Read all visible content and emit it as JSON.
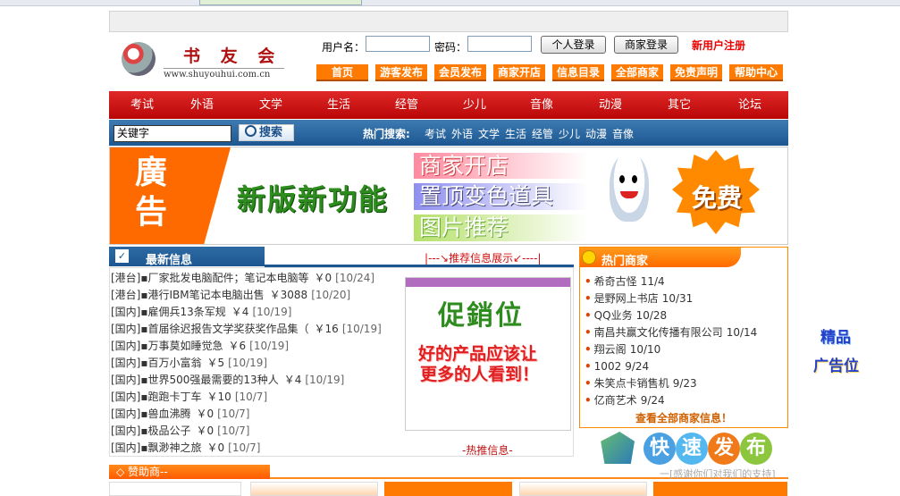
{
  "header": {
    "logo_text": "书 友 会",
    "logo_url": "www.shuyouhui.com.cn",
    "username_label": "用户名：",
    "password_label": "密码：",
    "login_personal": "个人登录",
    "login_merchant": "商家登录",
    "register": "新用户注册",
    "menu": [
      "首页",
      "游客发布",
      "会员发布",
      "商家开店",
      "信息目录",
      "全部商家",
      "免责声明",
      "帮助中心"
    ]
  },
  "nav": [
    "考试",
    "外语",
    "文学",
    "生活",
    "经管",
    "少儿",
    "音像",
    "动漫",
    "其它",
    "论坛"
  ],
  "search": {
    "value": "关键字",
    "button": "搜索",
    "hot_label": "热门搜索:",
    "hot_keywords": [
      "考试",
      "外语",
      "文学",
      "生活",
      "经管",
      "少儿",
      "动漫",
      "音像"
    ]
  },
  "banner": {
    "ad_char1": "廣",
    "ad_char2": "告",
    "slogan": "新版新功能",
    "features": [
      "商家开店",
      "置顶变色道具",
      "图片推荐"
    ],
    "free": "免费"
  },
  "latest": {
    "title": "最新信息",
    "recommend_link": "|---↘推荐信息展示↙----|",
    "items": [
      {
        "region": "[港台]",
        "title": "厂家批发电脑配件；笔记本电脑等",
        "price": "￥0",
        "date": "[10/24]"
      },
      {
        "region": "[港台]",
        "title": "港行IBM笔记本电脑出售",
        "price": "￥3088",
        "date": "[10/20]"
      },
      {
        "region": "[国内]",
        "title": "雇佣兵13条军规",
        "price": "￥4",
        "date": "[10/19]"
      },
      {
        "region": "[国内]",
        "title": "首届徐迟报告文学奖获奖作品集（",
        "price": "￥16",
        "date": "[10/19]"
      },
      {
        "region": "[国内]",
        "title": "万事莫如睡觉急",
        "price": "￥6",
        "date": "[10/19]"
      },
      {
        "region": "[国内]",
        "title": "百万小富翁",
        "price": "￥5",
        "date": "[10/19]"
      },
      {
        "region": "[国内]",
        "title": "世界500强最需要的13种人",
        "price": "￥4",
        "date": "[10/19]"
      },
      {
        "region": "[国内]",
        "title": "跑跑卡丁车",
        "price": "￥10",
        "date": "[10/7]"
      },
      {
        "region": "[国内]",
        "title": "兽血沸腾",
        "price": "￥0",
        "date": "[10/7]"
      },
      {
        "region": "[国内]",
        "title": "极品公子",
        "price": "￥0",
        "date": "[10/7]"
      },
      {
        "region": "[国内]",
        "title": "飘渺神之旅",
        "price": "￥0",
        "date": "[10/7]"
      }
    ]
  },
  "promo": {
    "title": "促銷位",
    "line1": "好的产品应该让",
    "line2": "更多的人看到！",
    "hot_info": "-热推信息-"
  },
  "merchants": {
    "title": "热门商家",
    "items": [
      {
        "name": "希奇古怪",
        "date": "11/4"
      },
      {
        "name": "是野网上书店",
        "date": "10/31"
      },
      {
        "name": "QQ业务",
        "date": "10/28"
      },
      {
        "name": "南昌共赢文化传播有限公司",
        "date": "10/14"
      },
      {
        "name": "翔云阁",
        "date": "10/10"
      },
      {
        "name": "1002",
        "date": "9/24"
      },
      {
        "name": "朱笑点卡销售机",
        "date": "9/23"
      },
      {
        "name": "亿商艺术",
        "date": "9/24"
      }
    ],
    "view_all": "查看全部商家信息！"
  },
  "quick_publish": [
    "快",
    "速",
    "发",
    "布"
  ],
  "side_ad": {
    "line1": "精品",
    "line2": "广告位"
  },
  "sponsor": {
    "title": "◇ 赞助商--",
    "thanks": "一[感谢你们对我们的支持]"
  },
  "colors": {
    "nav_red": "#c81010",
    "search_blue": "#2d6aa4",
    "accent_orange": "#ff7a00"
  }
}
